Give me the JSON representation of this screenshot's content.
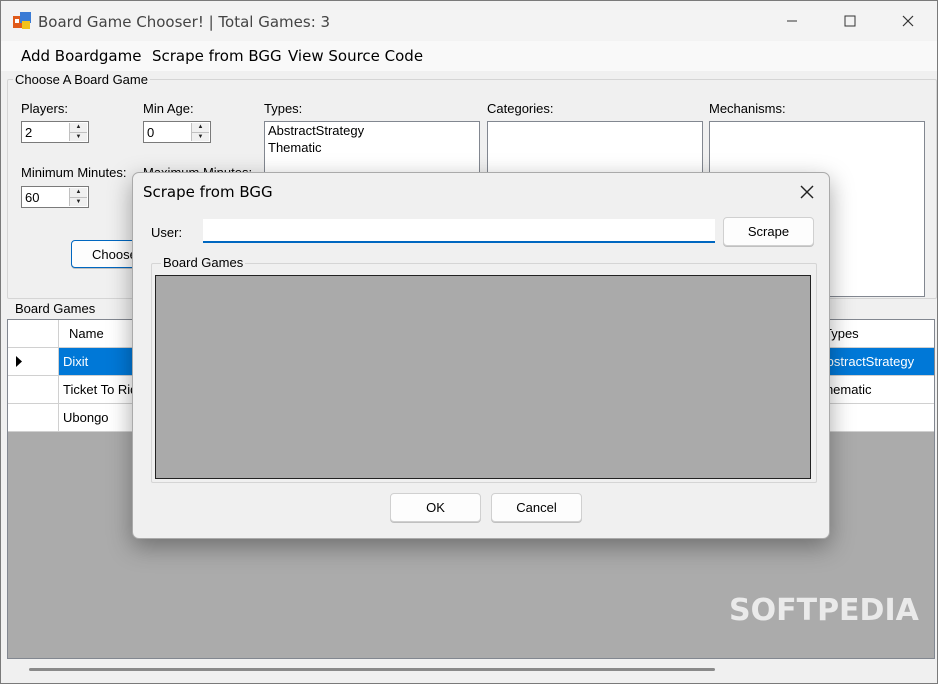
{
  "window": {
    "title": "Board Game Chooser! | Total Games: 3"
  },
  "menu": [
    "Add Boardgame",
    "Scrape from BGG",
    "View Source Code"
  ],
  "chooser": {
    "group_title": "Choose A Board Game",
    "players_label": "Players:",
    "players_value": "2",
    "min_age_label": "Min Age:",
    "min_age_value": "0",
    "min_minutes_label": "Minimum Minutes:",
    "min_minutes_value": "60",
    "max_minutes_label": "Maximum Minutes:",
    "types_label": "Types:",
    "types_items": [
      "AbstractStrategy",
      "Thematic"
    ],
    "categories_label": "Categories:",
    "mechanisms_label": "Mechanisms:",
    "choose_button": "Choose"
  },
  "board_games": {
    "group_title": "Board Games",
    "columns": [
      "Name",
      "Types"
    ],
    "rows": [
      {
        "name": "Dixit",
        "types": "AbstractStrategy",
        "selected": true
      },
      {
        "name": "Ticket To Ride",
        "types": "Thematic",
        "selected": false
      },
      {
        "name": "Ubongo",
        "types": "",
        "selected": false
      }
    ]
  },
  "dialog": {
    "title": "Scrape from BGG",
    "user_label": "User:",
    "user_value": "",
    "scrape_button": "Scrape",
    "group_title": "Board Games",
    "ok_button": "OK",
    "cancel_button": "Cancel"
  },
  "watermark": "SOFTPEDIA",
  "colors": {
    "selection": "#0078d7",
    "accent": "#0067c0",
    "panel": "#ababab"
  }
}
